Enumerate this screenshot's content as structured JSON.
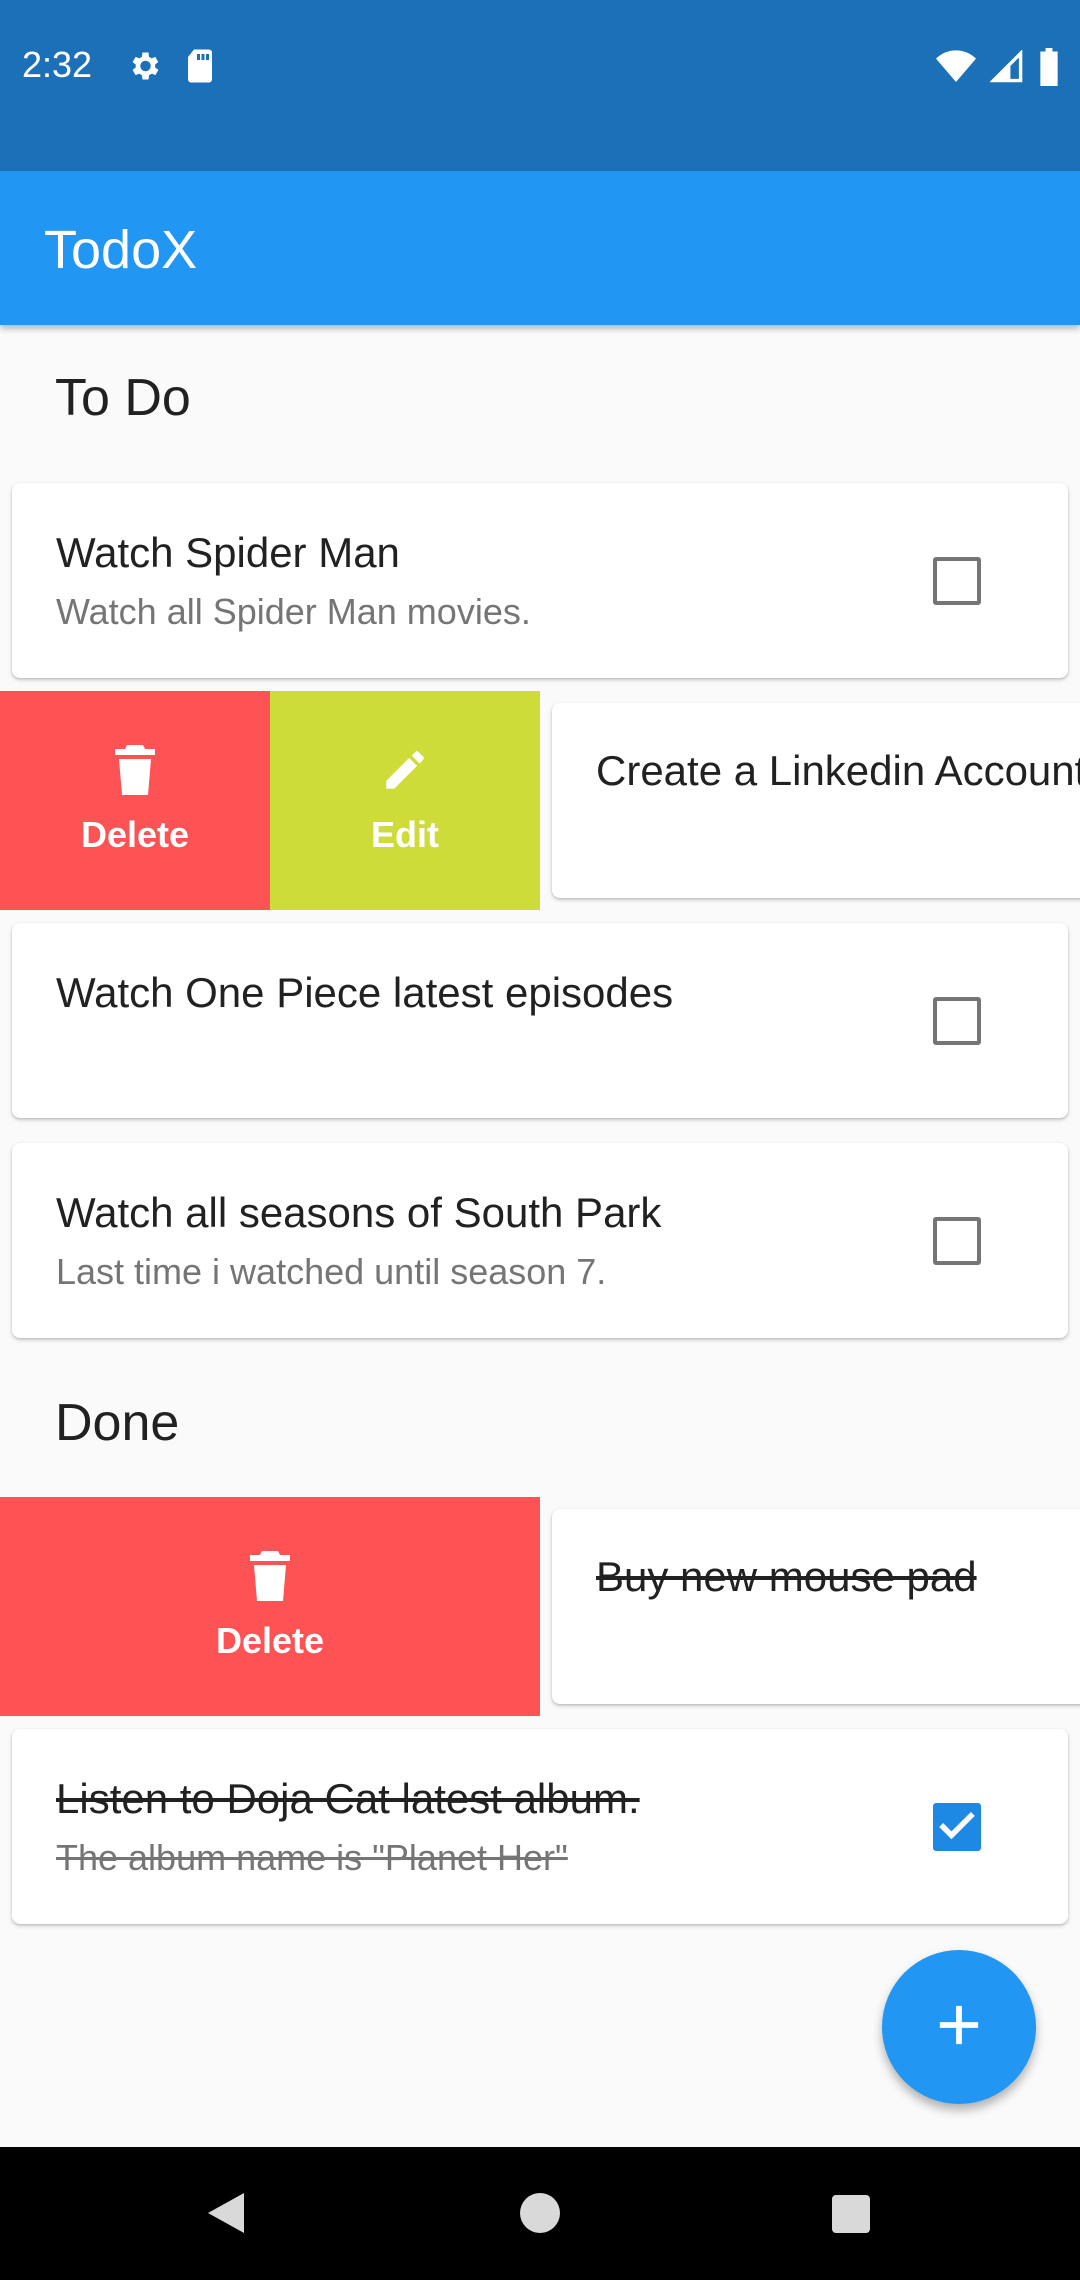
{
  "status_bar": {
    "time": "2:32",
    "left_icons": [
      "gear-icon",
      "sd-card-icon"
    ],
    "right_icons": [
      "wifi-icon",
      "signal-icon",
      "battery-icon"
    ],
    "background": "#1b70b8"
  },
  "app_bar": {
    "title": "TodoX",
    "background": "#2196f3"
  },
  "sections": {
    "todo_title": "To Do",
    "done_title": "Done"
  },
  "todo_items": [
    {
      "title": "Watch Spider Man",
      "subtitle": "Watch all Spider Man movies.",
      "checked": false
    },
    {
      "title": "Create a Linkedin Account",
      "subtitle": "",
      "checked": false,
      "swiped_actions": [
        "Delete",
        "Edit"
      ]
    },
    {
      "title": "Watch One Piece latest episodes",
      "subtitle": "",
      "checked": false
    },
    {
      "title": "Watch all seasons of South Park",
      "subtitle": "Last time i watched until season 7.",
      "checked": false
    }
  ],
  "done_items": [
    {
      "title": "Buy new mouse pad",
      "subtitle": "",
      "checked": true,
      "swiped_actions": [
        "Delete"
      ]
    },
    {
      "title": "Listen to Doja Cat latest album.",
      "subtitle": "The album name is \"Planet Her\"",
      "checked": true
    }
  ],
  "actions": {
    "delete_label": "Delete",
    "edit_label": "Edit",
    "delete_color": "#fe5355",
    "edit_color": "#cddc39"
  },
  "fab": {
    "icon": "plus-icon",
    "color": "#2196f3"
  },
  "nav_bar": {
    "buttons": [
      "back-icon",
      "home-icon",
      "recents-icon"
    ]
  }
}
